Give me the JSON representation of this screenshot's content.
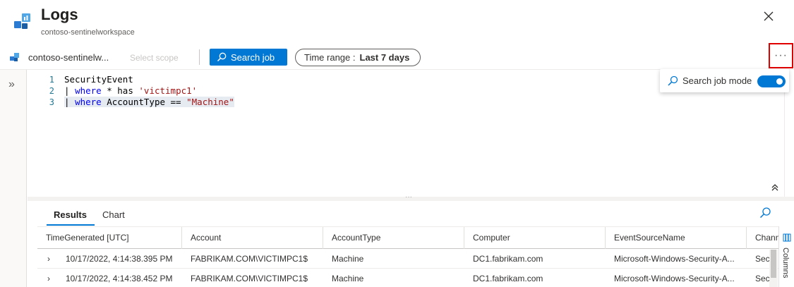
{
  "header": {
    "title": "Logs",
    "subtitle": "contoso-sentinelworkspace",
    "close_icon": "close-icon",
    "app_icon": "logs-icon"
  },
  "toolbar": {
    "workspace_name": "contoso-sentinelw...",
    "select_scope": "Select scope",
    "search_job_label": "Search job",
    "time_range_label": "Time range :",
    "time_range_value": "Last 7 days",
    "more_label": "···"
  },
  "popup": {
    "label": "Search job mode",
    "toggle_on": true
  },
  "editor": {
    "line_numbers": [
      "1",
      "2",
      "3"
    ],
    "line1": "SecurityEvent",
    "line2_pipe": "| ",
    "line2_kw": "where",
    "line2_rest": " * has ",
    "line2_str": "'victimpc1'",
    "line3_pipe": "| ",
    "line3_kw": "where",
    "line3_rest": " AccountType == ",
    "line3_str": "\"Machine\""
  },
  "results": {
    "tabs": [
      "Results",
      "Chart"
    ],
    "columns": [
      "TimeGenerated [UTC]",
      "Account",
      "AccountType",
      "Computer",
      "EventSourceName",
      "Chann"
    ],
    "rows": [
      [
        "10/17/2022, 4:14:38.395 PM",
        "FABRIKAM.COM\\VICTIMPC1$",
        "Machine",
        "DC1.fabrikam.com",
        "Microsoft-Windows-Security-A...",
        "Sec"
      ],
      [
        "10/17/2022, 4:14:38.452 PM",
        "FABRIKAM.COM\\VICTIMPC1$",
        "Machine",
        "DC1.fabrikam.com",
        "Microsoft-Windows-Security-A...",
        "Sec"
      ]
    ],
    "columns_panel_label": "Columns"
  },
  "colors": {
    "accent": "#0078d4",
    "highlight_border": "#e00000"
  }
}
